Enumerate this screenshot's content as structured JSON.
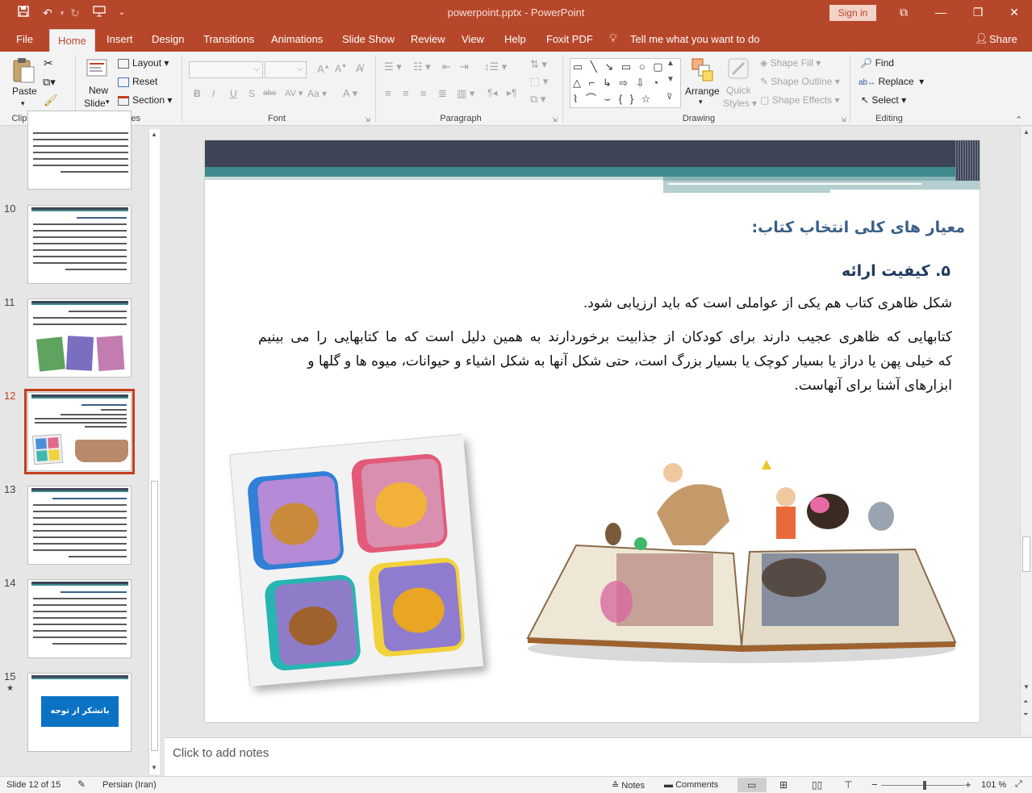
{
  "window": {
    "title": "powerpoint.pptx  -  PowerPoint",
    "sign_in": "Sign in"
  },
  "qat": {
    "save": "save-icon",
    "undo": "undo-icon",
    "redo": "redo-icon",
    "present": "present-icon"
  },
  "tabs": [
    "File",
    "Home",
    "Insert",
    "Design",
    "Transitions",
    "Animations",
    "Slide Show",
    "Review",
    "View",
    "Help",
    "Foxit PDF"
  ],
  "tell_me": "Tell me what you want to do",
  "share": "Share",
  "ribbon": {
    "clipboard": {
      "label": "Clipboard",
      "paste": "Paste"
    },
    "slides": {
      "label": "Slides",
      "new_slide_1": "New",
      "new_slide_2": "Slide",
      "layout": "Layout",
      "reset": "Reset",
      "section": "Section"
    },
    "font": {
      "label": "Font",
      "bold": "B",
      "italic": "I",
      "underline": "U",
      "shadow": "S",
      "strike": "abc",
      "spacing": "AV",
      "case": "Aa",
      "color": "A"
    },
    "paragraph": {
      "label": "Paragraph"
    },
    "drawing": {
      "label": "Drawing",
      "arrange": "Arrange",
      "quick_styles_1": "Quick",
      "quick_styles_2": "Styles",
      "shape_fill": "Shape Fill",
      "shape_outline": "Shape Outline",
      "shape_effects": "Shape Effects"
    },
    "editing": {
      "label": "Editing",
      "find": "Find",
      "replace": "Replace",
      "select": "Select"
    }
  },
  "thumbnails": {
    "numbers": [
      "10",
      "11",
      "12",
      "13",
      "14",
      "15"
    ],
    "selected": "12",
    "slide15_text": "باتشکر از توجه شما"
  },
  "slide": {
    "heading": "معیار های کلی انتخاب کتاب:",
    "subheading": "۵. کیفیت ارائه",
    "line1": "شکل ظاهری کتاب هم یکی از عواملی است که باید ارزیابی شود.",
    "para_line1": "کتابهایی که ظاهری عجیب دارند برای کودکان از جذابیت برخوردارند به همین دلیل است که ما کتابهایی را می بینیم",
    "para_line2": "که خیلی پهن یا دراز یا بسیار کوچک یا بسیار بزرگ است، حتی شکل آنها به شکل اشیاء و حیوانات، میوه ها و گلها و",
    "para_line3": "ابزارهای آشنا برای آنهاست.",
    "accent_dark": "#3d4456",
    "accent_teal": "#3f8a8c",
    "heading_color": "#3b5f86"
  },
  "notes": {
    "placeholder": "Click to add notes"
  },
  "status": {
    "slide_indicator": "Slide 12 of 15",
    "language": "Persian (Iran)",
    "notes": "Notes",
    "comments": "Comments",
    "zoom": "101 %",
    "zoom_level": 0.5
  }
}
